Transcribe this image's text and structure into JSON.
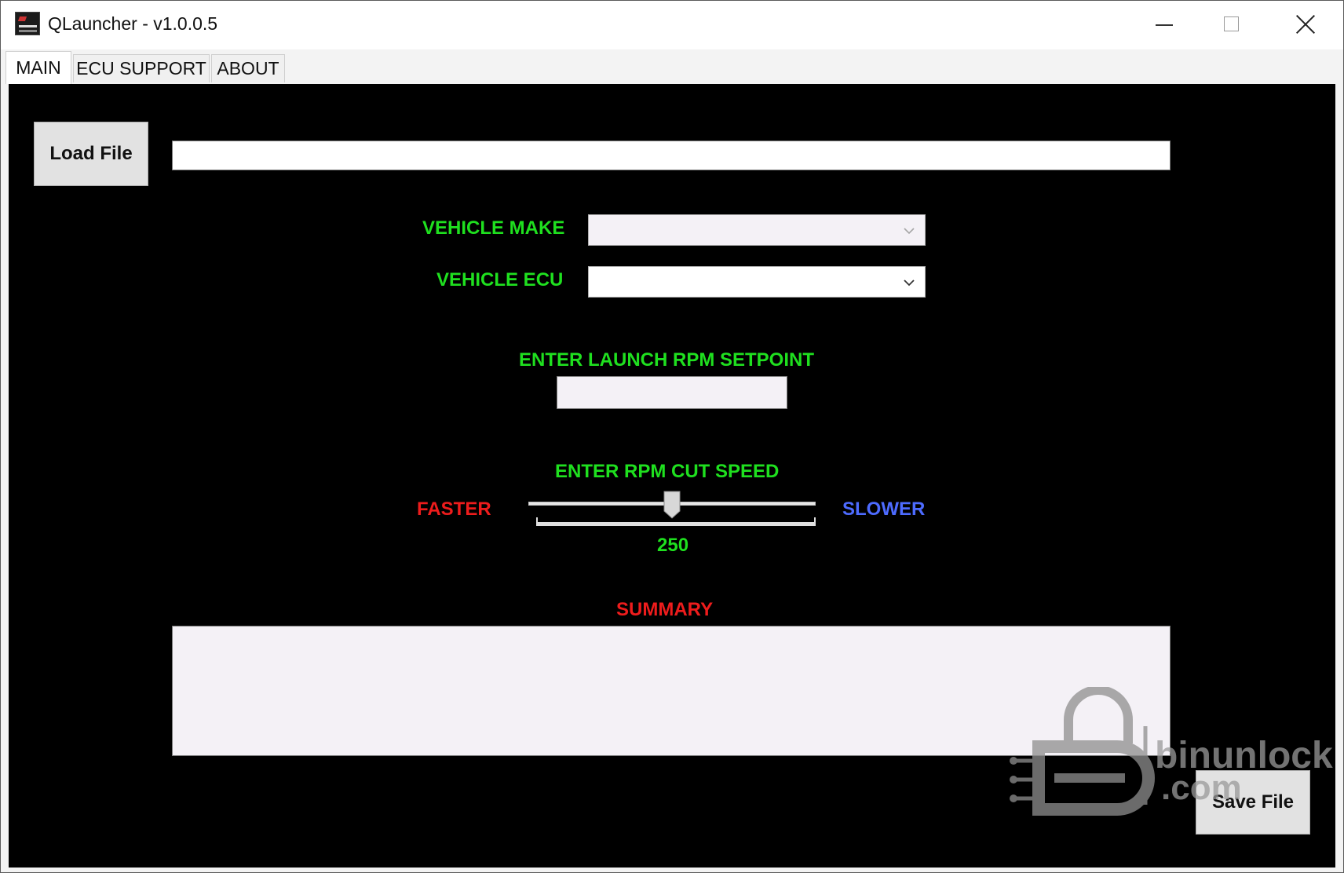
{
  "window": {
    "title": "QLauncher - v1.0.0.5"
  },
  "tabs": [
    {
      "label": "MAIN",
      "active": true
    },
    {
      "label": "ECU SUPPORT",
      "active": false
    },
    {
      "label": "ABOUT",
      "active": false
    }
  ],
  "main": {
    "load_file_label": "Load File",
    "file_path_value": "",
    "vehicle_make": {
      "label": "VEHICLE MAKE",
      "value": ""
    },
    "vehicle_ecu": {
      "label": "VEHICLE ECU",
      "value": ""
    },
    "launch_rpm": {
      "label": "ENTER LAUNCH RPM SETPOINT",
      "value": ""
    },
    "rpm_cut_speed": {
      "label": "ENTER RPM CUT SPEED",
      "faster_label": "FASTER",
      "slower_label": "SLOWER",
      "value_text": "250",
      "position_fraction": 0.5
    },
    "summary": {
      "label": "SUMMARY",
      "text": ""
    },
    "save_file_label": "Save File"
  },
  "watermark": {
    "line1": "binunlock",
    "line2": ".com"
  },
  "colors": {
    "label_green": "#1fe01f",
    "faster_red": "#ee1c1c",
    "slower_blue": "#4d6bff",
    "summary_red": "#ee1c1c",
    "panel_bg": "#000000"
  },
  "icons": {
    "app": "qlauncher-logo-icon",
    "minimize": "minimize-icon",
    "maximize": "maximize-icon",
    "close": "close-icon",
    "dropdown": "chevron-down-icon",
    "slider_thumb": "slider-thumb-icon",
    "watermark": "padlock-logo-icon"
  }
}
